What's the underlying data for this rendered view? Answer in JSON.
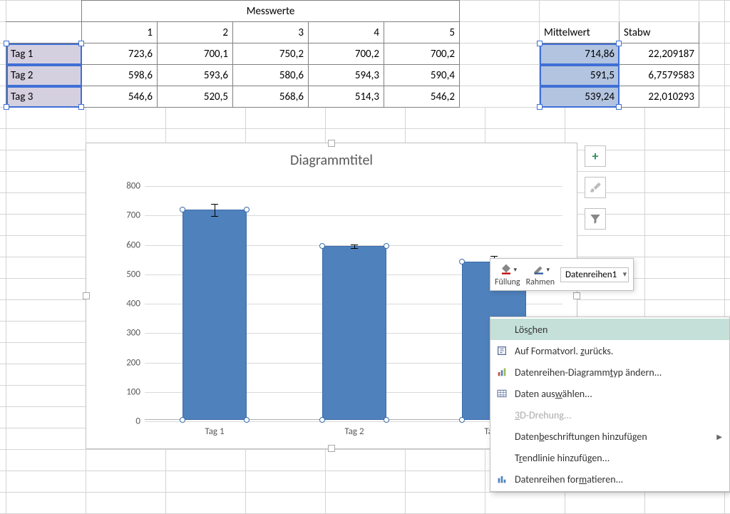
{
  "table": {
    "messwerte_label": "Messwerte",
    "col_headers": [
      "1",
      "2",
      "3",
      "4",
      "5"
    ],
    "stat_headers": [
      "Mittelwert",
      "Stabw"
    ],
    "rows": [
      {
        "label": "Tag 1",
        "values": [
          "723,6",
          "700,1",
          "750,2",
          "700,2",
          "700,2"
        ],
        "mw": "714,86",
        "stabw": "22,209187"
      },
      {
        "label": "Tag 2",
        "values": [
          "598,6",
          "593,6",
          "580,6",
          "594,3",
          "590,4"
        ],
        "mw": "591,5",
        "stabw": "6,7579583"
      },
      {
        "label": "Tag 3",
        "values": [
          "546,6",
          "520,5",
          "568,6",
          "514,3",
          "546,2"
        ],
        "mw": "539,24",
        "stabw": "22,010293"
      }
    ]
  },
  "chart_data": {
    "type": "bar",
    "title": "Diagrammtitel",
    "categories": [
      "Tag 1",
      "Tag 2",
      "Tag 3"
    ],
    "values": [
      714.86,
      591.5,
      539.24
    ],
    "errors": [
      22.21,
      6.76,
      22.01
    ],
    "ylim": [
      0,
      800
    ],
    "yticks": [
      0,
      100,
      200,
      300,
      400,
      500,
      600,
      700,
      800
    ],
    "series_name": "Datenreihen1"
  },
  "mini_toolbar": {
    "fill_label": "Füllung",
    "outline_label": "Rahmen",
    "series_dropdown": "Datenreihen1"
  },
  "context_menu": {
    "items": [
      {
        "key": "delete",
        "label": "Löschen",
        "icon": "",
        "hover": true
      },
      {
        "key": "reset",
        "label": "Auf Formatvorl. zurücks.",
        "icon": "reset"
      },
      {
        "key": "chtype",
        "label": "Datenreihen-Diagrammtyp ändern...",
        "icon": "chart"
      },
      {
        "key": "select",
        "label": "Daten auswählen...",
        "icon": "table"
      },
      {
        "key": "rotate3d",
        "label": "3D-Drehung...",
        "icon": "",
        "disabled": true
      },
      {
        "key": "labels",
        "label": "Datenbeschriftungen hinzufügen",
        "icon": "",
        "submenu": true
      },
      {
        "key": "trend",
        "label": "Trendlinie hinzufügen...",
        "icon": ""
      },
      {
        "key": "format",
        "label": "Datenreihen formatieren...",
        "icon": "bars"
      }
    ]
  },
  "side_buttons": {
    "plus_tooltip": "Diagrammelemente",
    "brush_tooltip": "Diagrammformatvorlagen",
    "filter_tooltip": "Diagrammfilter"
  }
}
